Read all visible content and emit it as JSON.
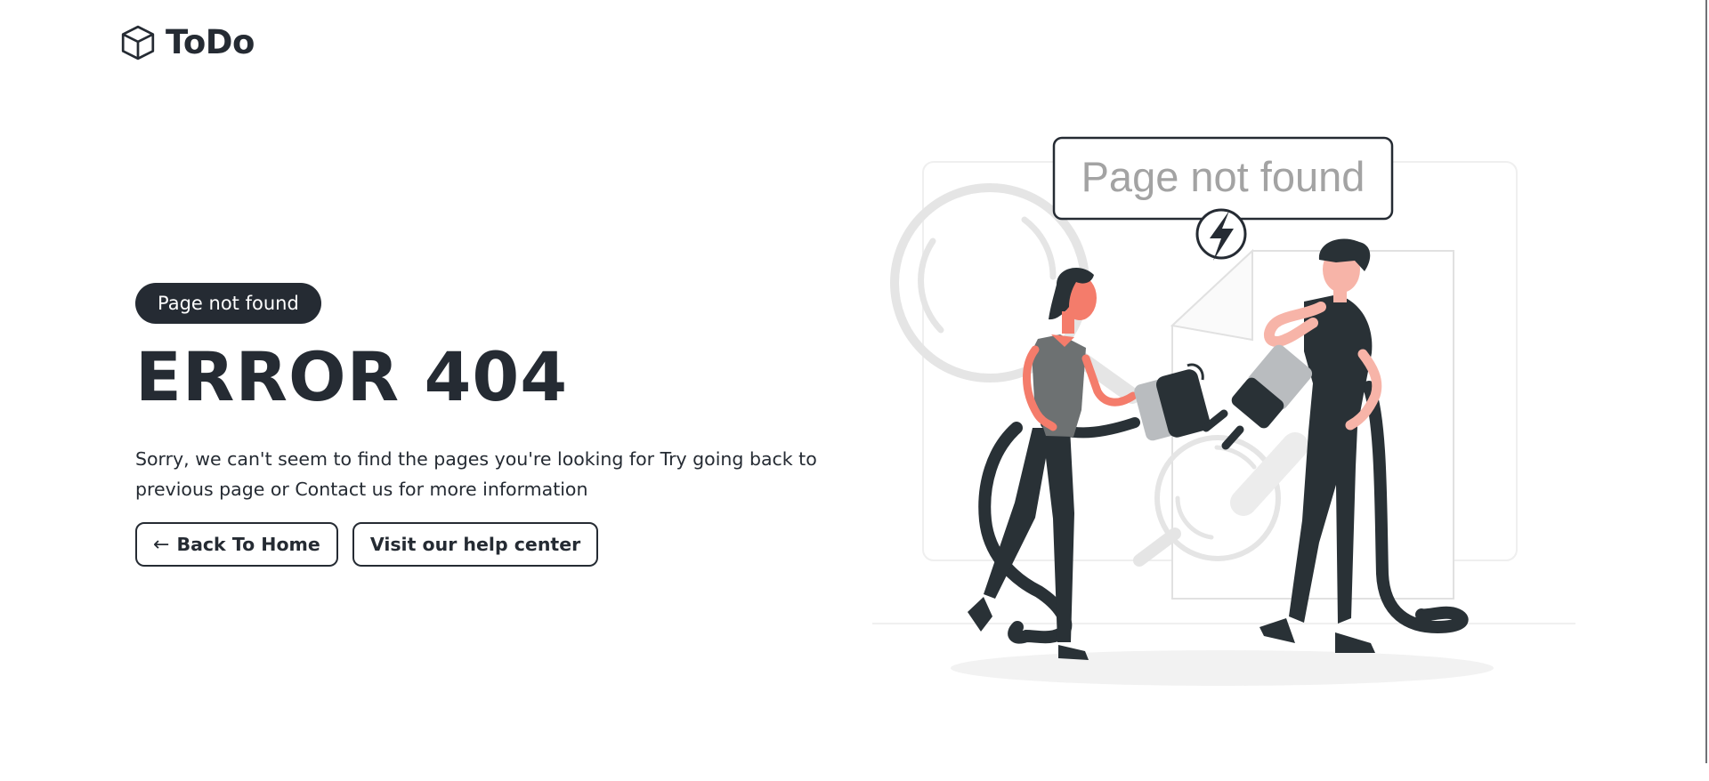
{
  "header": {
    "brand": "ToDo",
    "logo_icon": "cube-icon"
  },
  "hero": {
    "badge": "Page not found",
    "title": "ERROR 404",
    "description": "Sorry, we can't seem to find the pages you're looking for Try going back to previous page or Contact us for more information",
    "back_button": {
      "icon": "arrow-left-icon",
      "label": "Back To Home"
    },
    "help_button": {
      "label": "Visit our help center"
    }
  },
  "illustration": {
    "speech_bubble": "Page not found"
  },
  "colors": {
    "primary": "#252b33",
    "accent": "#f47c6b",
    "muted": "#a3a3a3",
    "background": "#ffffff"
  }
}
